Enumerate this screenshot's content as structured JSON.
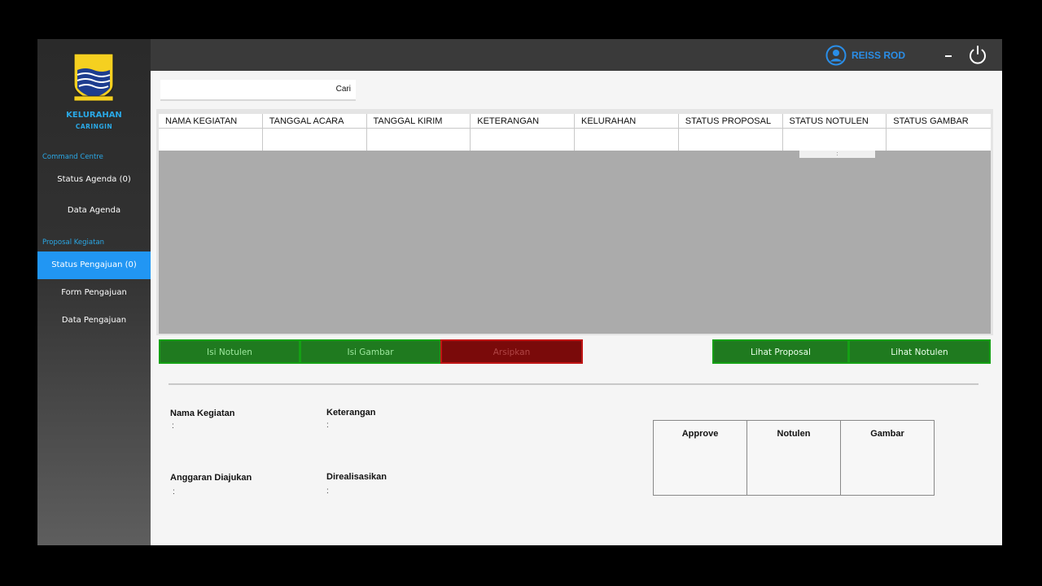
{
  "sidebar": {
    "kelurahan_title": "KELURAHAN",
    "kelurahan_sub": "CARINGIN",
    "section_command": "Command Centre",
    "item_status_agenda": "Status Agenda (0)",
    "item_data_agenda": "Data Agenda",
    "section_proposal": "Proposal Kegiatan",
    "item_status_pengajuan": "Status Pengajuan (0)",
    "item_form_pengajuan": "Form Pengajuan",
    "item_data_pengajuan": "Data Pengajuan",
    "active_color": "#2196f3",
    "accent_color": "#2aa8e6"
  },
  "header": {
    "user_name": "REISS ROD",
    "user_icon": "user-circle-icon",
    "minimize_icon": "minimize-icon",
    "power_icon": "power-icon"
  },
  "search": {
    "value": "",
    "label": "Cari"
  },
  "table": {
    "columns": [
      "NAMA KEGIATAN",
      "TANGGAL ACARA",
      "TANGGAL KIRIM",
      "KETERANGAN",
      "KELURAHAN",
      "STATUS PROPOSAL",
      "STATUS NOTULEN",
      "STATUS GAMBAR"
    ],
    "rows": [
      [
        "",
        "",
        "",
        "",
        "",
        "",
        "",
        ""
      ]
    ],
    "tooltip": ":"
  },
  "actions": {
    "isi_notulen": "Isi Notulen",
    "isi_gambar": "Isi Gambar",
    "arsipkan": "Arsipkan",
    "lihat_proposal": "Lihat Proposal",
    "lihat_notulen": "Lihat Notulen"
  },
  "details": {
    "nama_kegiatan_label": "Nama Kegiatan",
    "nama_kegiatan_value": ":",
    "keterangan_label": "Keterangan",
    "keterangan_value": ":",
    "anggaran_label": "Anggaran Diajukan",
    "anggaran_value": ":",
    "direalisasikan_label": "Direalisasikan",
    "direalisasikan_value": ":"
  },
  "status_box": {
    "approve": "Approve",
    "notulen": "Notulen",
    "gambar": "Gambar"
  },
  "colors": {
    "green": "#1f7a1f",
    "red": "#7a0a0a",
    "header": "#3a3a3a"
  }
}
